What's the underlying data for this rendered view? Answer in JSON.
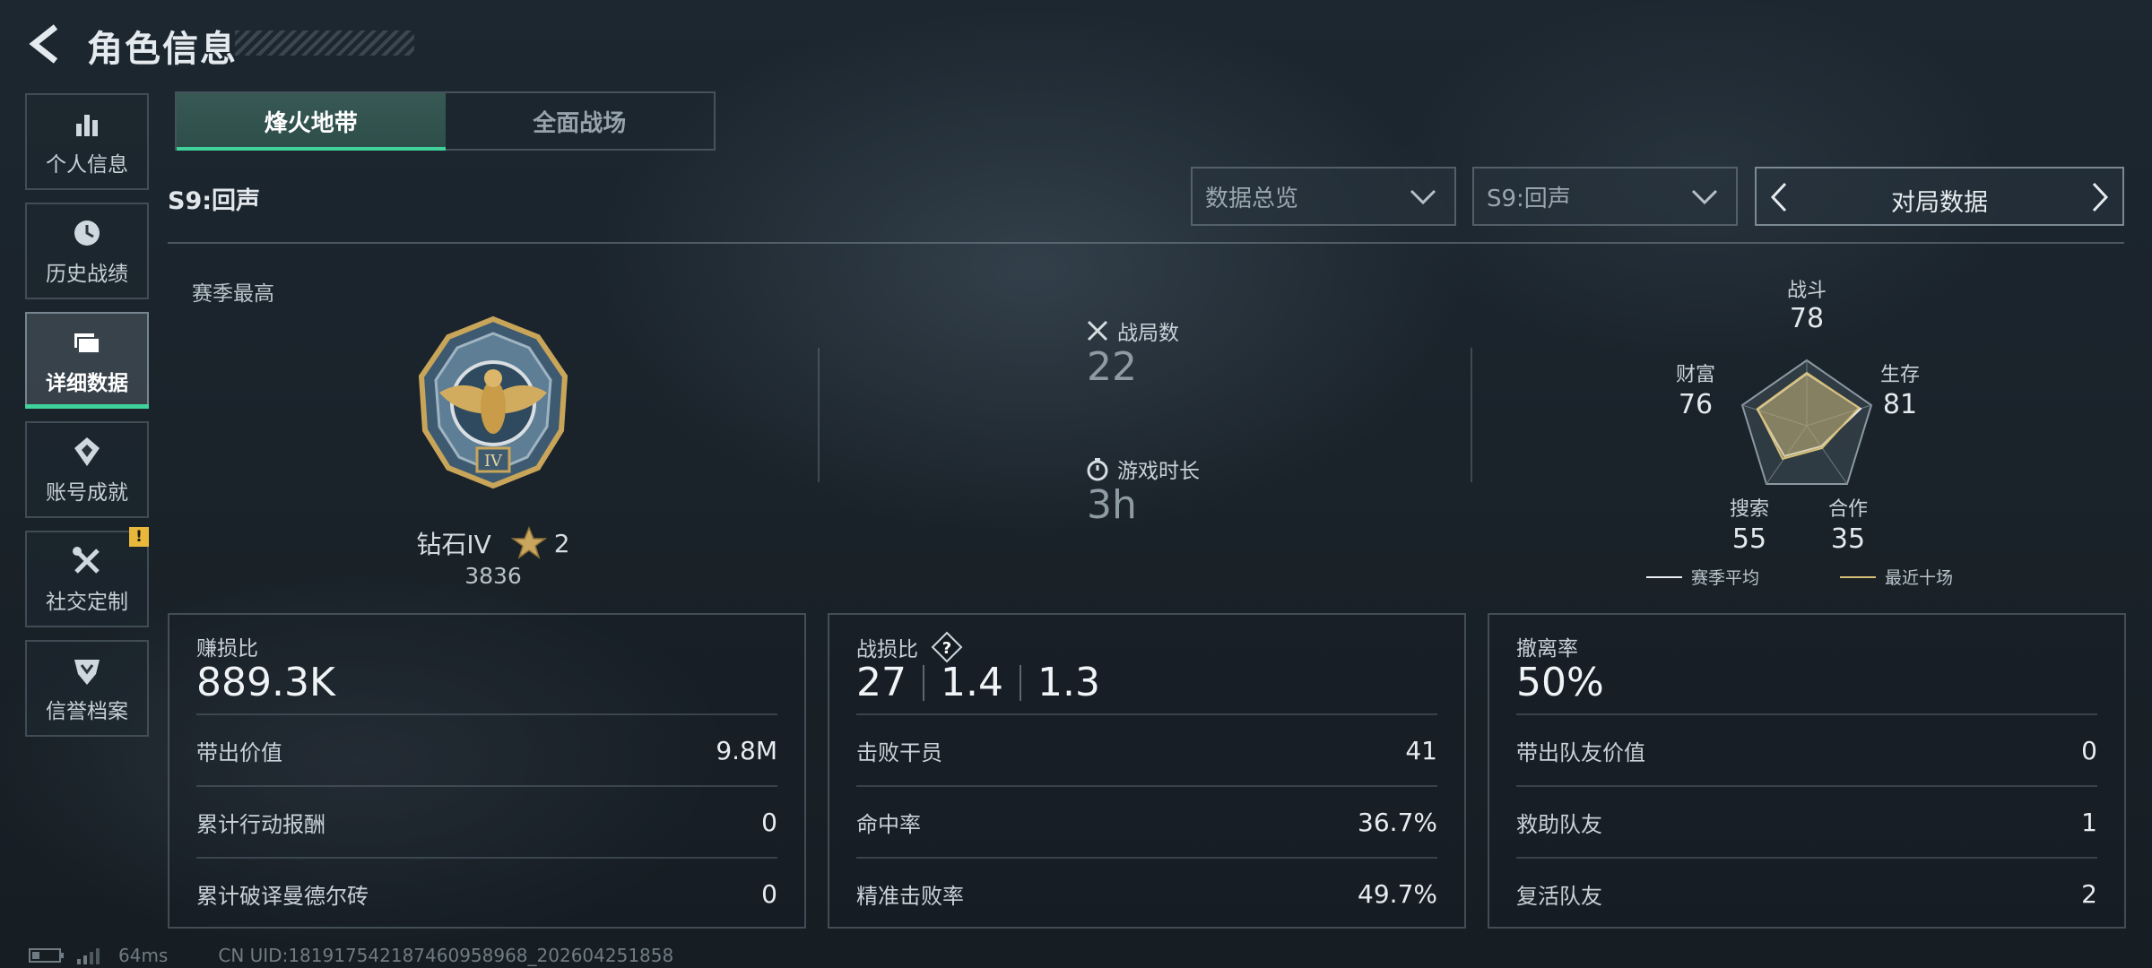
{
  "header": {
    "title": "角色信息"
  },
  "sidebar": {
    "items": [
      {
        "label": "个人信息",
        "icon": "bar-chart-icon"
      },
      {
        "label": "历史战绩",
        "icon": "history-icon"
      },
      {
        "label": "详细数据",
        "icon": "folder-icon",
        "active": true
      },
      {
        "label": "账号成就",
        "icon": "achievement-icon"
      },
      {
        "label": "社交定制",
        "icon": "tools-icon",
        "badge": "!"
      },
      {
        "label": "信誉档案",
        "icon": "credit-shield-icon"
      }
    ]
  },
  "tabs": [
    {
      "label": "烽火地带",
      "active": true
    },
    {
      "label": "全面战场",
      "active": false
    }
  ],
  "season_label": "S9:回声",
  "filters": {
    "dropdown1": "数据总览",
    "dropdown2": "S9:回声",
    "pager": "对局数据"
  },
  "season_best": {
    "label": "赛季最高",
    "rank": "钻石IV",
    "stars": "2",
    "score": "3836"
  },
  "overview": {
    "matches_label": "战局数",
    "matches_value": "22",
    "time_label": "游戏时长",
    "time_value": "3h"
  },
  "radar": {
    "axes": [
      {
        "label": "战斗",
        "value": "78"
      },
      {
        "label": "生存",
        "value": "81"
      },
      {
        "label": "合作",
        "value": "35"
      },
      {
        "label": "搜索",
        "value": "55"
      },
      {
        "label": "财富",
        "value": "76"
      }
    ],
    "legend_avg": "赛季平均",
    "legend_recent": "最近十场",
    "colors": {
      "avg": "#e8eef2",
      "recent": "#d8c077"
    }
  },
  "cards": {
    "profit": {
      "title": "赚损比",
      "value": "889.3K",
      "rows": [
        {
          "k": "带出价值",
          "v": "9.8M"
        },
        {
          "k": "累计行动报酬",
          "v": "0"
        },
        {
          "k": "累计破译曼德尔砖",
          "v": "0"
        }
      ]
    },
    "kd": {
      "title": "战损比",
      "help": "?",
      "values": [
        "27",
        "1.4",
        "1.3"
      ],
      "rows": [
        {
          "k": "击败干员",
          "v": "41"
        },
        {
          "k": "命中率",
          "v": "36.7%"
        },
        {
          "k": "精准击败率",
          "v": "49.7%"
        }
      ]
    },
    "extract": {
      "title": "撤离率",
      "value": "50%",
      "rows": [
        {
          "k": "带出队友价值",
          "v": "0"
        },
        {
          "k": "救助队友",
          "v": "1"
        },
        {
          "k": "复活队友",
          "v": "2"
        }
      ]
    }
  },
  "footer": {
    "ping": "64ms",
    "uid": "CN UID:181917542187460958968_202604251858"
  }
}
